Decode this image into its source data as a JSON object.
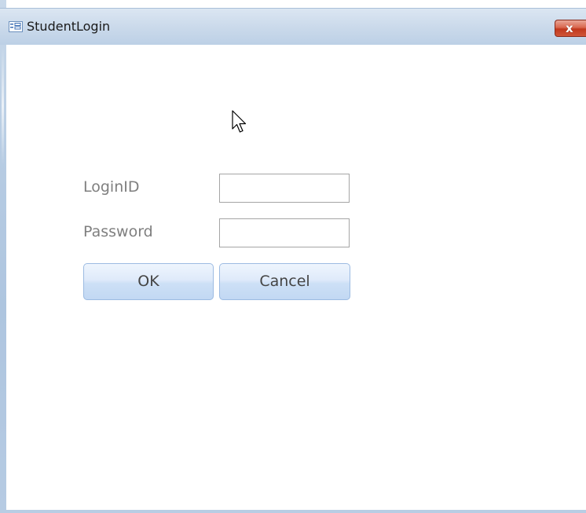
{
  "window": {
    "title": "StudentLogin",
    "icon": "form-icon",
    "close_label": "x"
  },
  "form": {
    "login_label": "LoginID",
    "login_value": "",
    "password_label": "Password",
    "password_value": "",
    "ok_label": "OK",
    "cancel_label": "Cancel"
  },
  "colors": {
    "close_button": "#c1381d",
    "button_fill": "#cde0f6",
    "label_text": "#7f7f7f"
  }
}
